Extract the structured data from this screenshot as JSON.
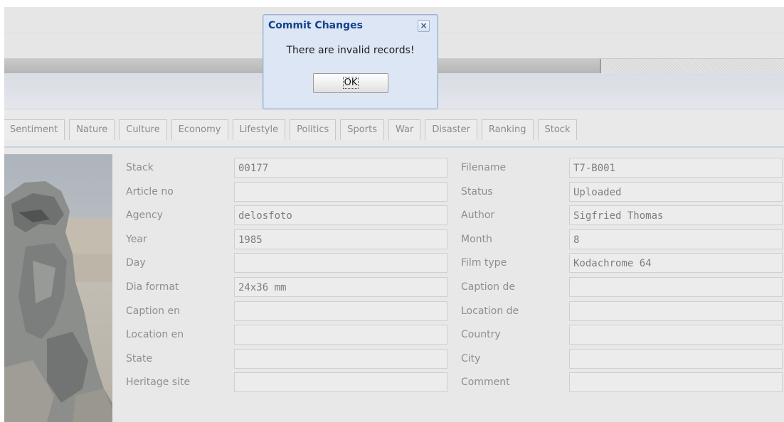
{
  "dialog": {
    "title": "Commit Changes",
    "message": "There are invalid records!",
    "ok_label": "OK",
    "close_glyph": "×",
    "close_icon": "close-icon"
  },
  "progress": {
    "fill_fraction": 0.764
  },
  "tabs": [
    {
      "label": "Sentiment"
    },
    {
      "label": "Nature"
    },
    {
      "label": "Culture"
    },
    {
      "label": "Economy"
    },
    {
      "label": "Lifestyle"
    },
    {
      "label": "Politics"
    },
    {
      "label": "Sports"
    },
    {
      "label": "War"
    },
    {
      "label": "Disaster"
    },
    {
      "label": "Ranking"
    },
    {
      "label": "Stock"
    }
  ],
  "form": {
    "left": [
      {
        "label": "Stack",
        "value": "00177"
      },
      {
        "label": "Article no",
        "value": ""
      },
      {
        "label": "Agency",
        "value": "delosfoto"
      },
      {
        "label": "Year",
        "value": "1985"
      },
      {
        "label": "Day",
        "value": ""
      },
      {
        "label": "Dia format",
        "value": "24x36 mm"
      },
      {
        "label": "Caption en",
        "value": ""
      },
      {
        "label": "Location en",
        "value": ""
      },
      {
        "label": "State",
        "value": ""
      },
      {
        "label": "Heritage site",
        "value": ""
      }
    ],
    "right": [
      {
        "label": "Filename",
        "value": "T7-B001"
      },
      {
        "label": "Status",
        "value": "Uploaded"
      },
      {
        "label": "Author",
        "value": "Sigfried Thomas"
      },
      {
        "label": "Month",
        "value": "8"
      },
      {
        "label": "Film type",
        "value": "Kodachrome 64"
      },
      {
        "label": "Caption de",
        "value": ""
      },
      {
        "label": "Location de",
        "value": ""
      },
      {
        "label": "Country",
        "value": ""
      },
      {
        "label": "City",
        "value": ""
      },
      {
        "label": "Comment",
        "value": ""
      }
    ]
  },
  "colors": {
    "dialog_title": "#15428b",
    "dialog_bg": "#dce6f4",
    "muted_text": "#8e8e8e"
  }
}
